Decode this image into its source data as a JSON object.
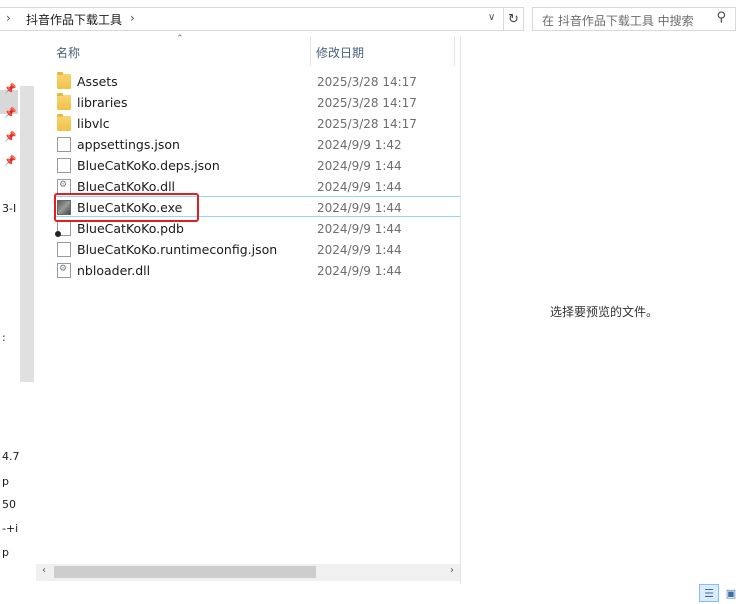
{
  "address": {
    "path_segment": "抖音作品下载工具",
    "search_placeholder": "在 抖音作品下载工具 中搜索"
  },
  "nav_fragments": [
    "3-I",
    ":",
    "4.7",
    "p",
    "50",
    "-+i",
    "p"
  ],
  "columns": {
    "name": "名称",
    "date_modified": "修改日期"
  },
  "files": [
    {
      "name": "Assets",
      "date": "2025/3/28 14:17",
      "type": "folder"
    },
    {
      "name": "libraries",
      "date": "2025/3/28 14:17",
      "type": "folder"
    },
    {
      "name": "libvlc",
      "date": "2025/3/28 14:17",
      "type": "folder"
    },
    {
      "name": "appsettings.json",
      "date": "2024/9/9 1:42",
      "type": "file"
    },
    {
      "name": "BlueCatKoKo.deps.json",
      "date": "2024/9/9 1:44",
      "type": "file"
    },
    {
      "name": "BlueCatKoKo.dll",
      "date": "2024/9/9 1:44",
      "type": "dll"
    },
    {
      "name": "BlueCatKoKo.exe",
      "date": "2024/9/9 1:44",
      "type": "exe"
    },
    {
      "name": "BlueCatKoKo.pdb",
      "date": "2024/9/9 1:44",
      "type": "pdb"
    },
    {
      "name": "BlueCatKoKo.runtimeconfig.json",
      "date": "2024/9/9 1:44",
      "type": "file"
    },
    {
      "name": "nbloader.dll",
      "date": "2024/9/9 1:44",
      "type": "dll"
    }
  ],
  "preview": {
    "message": "选择要预览的文件。"
  },
  "highlight_color": "#e02020"
}
